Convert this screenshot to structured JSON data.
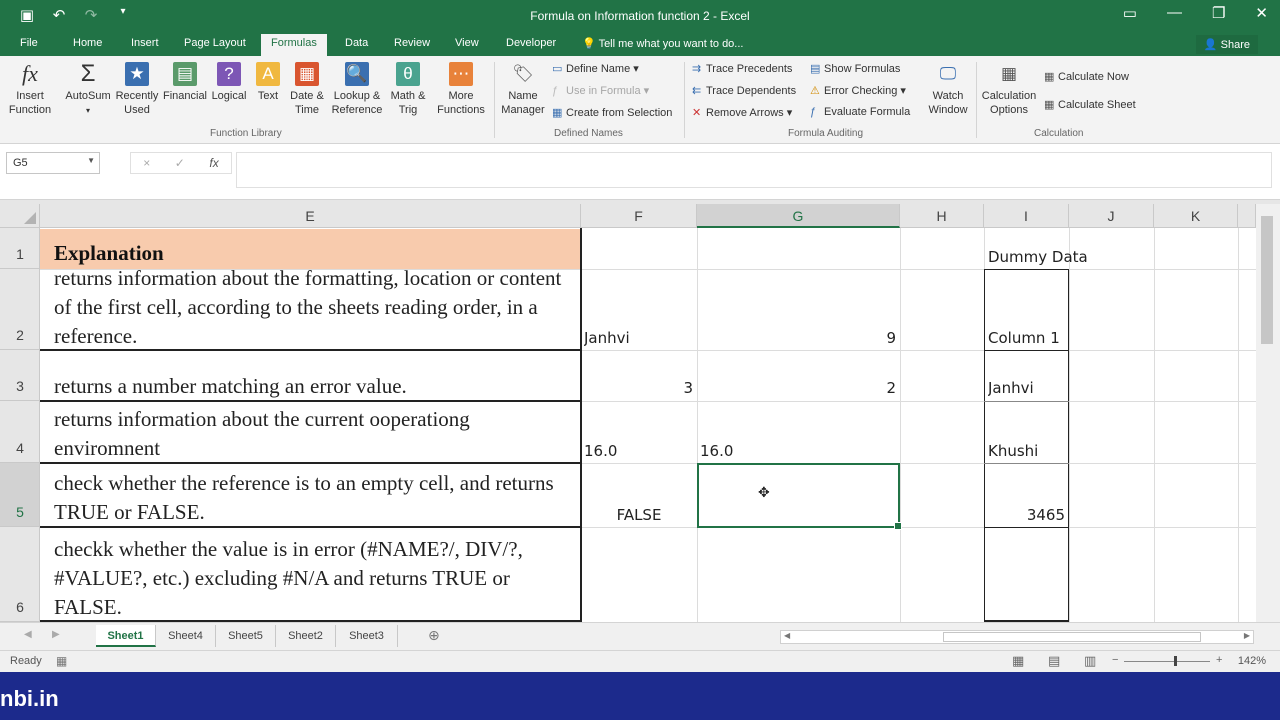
{
  "window": {
    "title": "Formula on Information function 2 - Excel"
  },
  "tabs": [
    {
      "label": "File"
    },
    {
      "label": "Home"
    },
    {
      "label": "Insert"
    },
    {
      "label": "Page Layout"
    },
    {
      "label": "Formulas",
      "active": true
    },
    {
      "label": "Data"
    },
    {
      "label": "Review"
    },
    {
      "label": "View"
    },
    {
      "label": "Developer"
    }
  ],
  "tell_me": "Tell me what you want to do...",
  "share_label": "Share",
  "ribbon": {
    "function_library": {
      "label": "Function Library",
      "buttons": [
        {
          "label": "Insert Function",
          "icon": "fx-icon"
        },
        {
          "label": "AutoSum",
          "icon": "sigma-icon"
        },
        {
          "label": "Recently Used",
          "icon": "star-book-icon"
        },
        {
          "label": "Financial",
          "icon": "financial-book-icon"
        },
        {
          "label": "Logical",
          "icon": "logical-book-icon"
        },
        {
          "label": "Text",
          "icon": "text-book-icon"
        },
        {
          "label": "Date & Time",
          "icon": "calendar-book-icon"
        },
        {
          "label": "Lookup & Reference",
          "icon": "lookup-book-icon"
        },
        {
          "label": "Math & Trig",
          "icon": "math-book-icon"
        },
        {
          "label": "More Functions",
          "icon": "more-book-icon"
        }
      ]
    },
    "defined_names": {
      "label": "Defined Names",
      "name_manager": "Name Manager",
      "define_name": "Define Name",
      "use_in_formula": "Use in Formula",
      "create_from_selection": "Create from Selection"
    },
    "formula_auditing": {
      "label": "Formula Auditing",
      "trace_precedents": "Trace Precedents",
      "trace_dependents": "Trace Dependents",
      "remove_arrows": "Remove Arrows",
      "show_formulas": "Show Formulas",
      "error_checking": "Error Checking",
      "evaluate_formula": "Evaluate Formula",
      "watch_window": "Watch Window"
    },
    "calculation": {
      "label": "Calculation",
      "options": "Calculation Options",
      "calc_now": "Calculate Now",
      "calc_sheet": "Calculate Sheet"
    }
  },
  "formula_bar": {
    "name_box": "G5",
    "cancel": "×",
    "enter": "✓",
    "fx": "fx"
  },
  "columns": [
    "E",
    "F",
    "G",
    "H",
    "I",
    "J",
    "K"
  ],
  "rows": [
    "1",
    "2",
    "3",
    "4",
    "5",
    "6"
  ],
  "cells": {
    "E1": "Explanation",
    "E2": "returns information about the formatting, location or content of the first cell, according to the sheets reading order, in a reference.",
    "E3": "returns a number matching an error value.",
    "E4": "returns information about the current ooperationg enviromnent",
    "E5": "check whether the reference is to an empty cell, and returns TRUE or FALSE.",
    "E6": "checkk whether the value is in error (#NAME?/, DIV/?, #VALUE?, etc.) excluding #N/A and returns TRUE or FALSE.",
    "F2": "Janhvi",
    "G2": "9",
    "F3": "3",
    "G3": "2",
    "F4": "16.0",
    "G4": "16.0",
    "F5": "FALSE",
    "I1": "Dummy Data",
    "I2": "Column 1",
    "I3": "Janhvi",
    "I4": "Khushi",
    "I5": "3465"
  },
  "sheets": [
    {
      "label": "Sheet1",
      "active": true
    },
    {
      "label": "Sheet4"
    },
    {
      "label": "Sheet5"
    },
    {
      "label": "Sheet2"
    },
    {
      "label": "Sheet3"
    }
  ],
  "status": {
    "ready": "Ready",
    "zoom": "142%"
  },
  "watermark": "nbi.in",
  "colors": {
    "excel_green": "#217346",
    "header_fill": "#f8cbad",
    "taskbar_blue": "#1c2a8c"
  }
}
